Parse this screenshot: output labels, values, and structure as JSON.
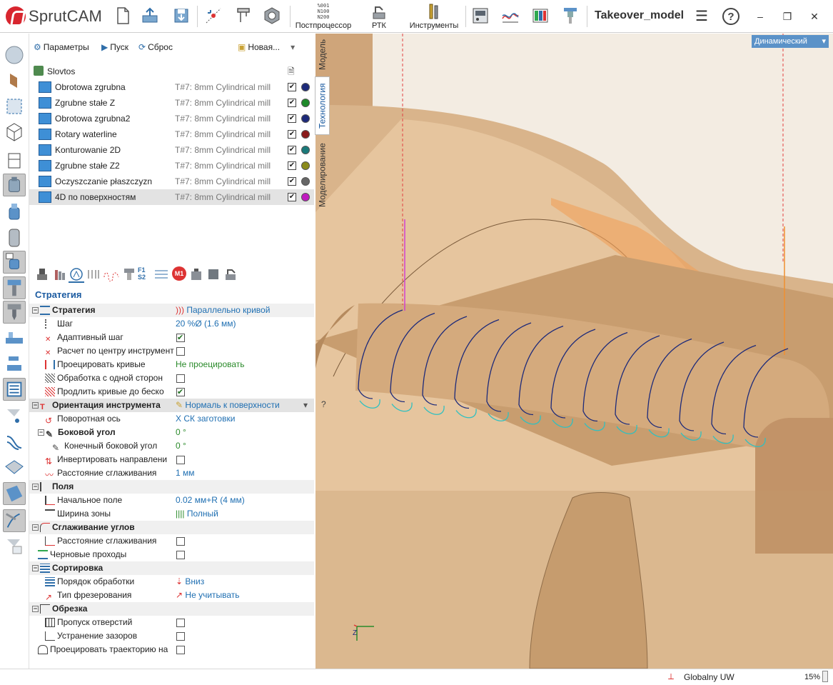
{
  "app": {
    "logo_text": "SprutCAM",
    "title": "Takeover_model"
  },
  "toolbar": {
    "postprocessor_label": "Постпроцессор",
    "postprocessor_icon_text": "%001\nN100\nN200",
    "rtk_label": "РТК",
    "tools_label": "Инструменты"
  },
  "panel_toolbar": {
    "params_label": "Параметры",
    "run_label": "Пуск",
    "reset_label": "Сброс",
    "new_label": "Новая..."
  },
  "vertical_tabs": {
    "model": "Модель",
    "technology": "Технология",
    "modeling": "Моделирование"
  },
  "tree": {
    "root": "Slovtos",
    "operations": [
      {
        "name": "Obrotowa zgrubna",
        "tool": "T#7: 8mm Cylindrical mill",
        "color": "#1d2a7a"
      },
      {
        "name": "Zgrubne stałe Z",
        "tool": "T#7: 8mm Cylindrical mill",
        "color": "#1e8a2a"
      },
      {
        "name": "Obrotowa zgrubna2",
        "tool": "T#7: 8mm Cylindrical mill",
        "color": "#1d2a7a"
      },
      {
        "name": "Rotary waterline",
        "tool": "T#7: 8mm Cylindrical mill",
        "color": "#8a1a1a"
      },
      {
        "name": "Konturowanie 2D",
        "tool": "T#7: 8mm Cylindrical mill",
        "color": "#1a7a7a"
      },
      {
        "name": "Zgrubne stałe Z2",
        "tool": "T#7: 8mm Cylindrical mill",
        "color": "#8a8a1a"
      },
      {
        "name": "Oczyszczanie płaszczyzn",
        "tool": "T#7: 8mm Cylindrical mill",
        "color": "#666666"
      },
      {
        "name": "4D по поверхностям",
        "tool": "T#7: 8mm Cylindrical mill",
        "color": "#c01ac0"
      }
    ]
  },
  "props_toolbar": {
    "f1": "F1",
    "s2": "S2",
    "m1": "M1"
  },
  "section_title": "Стратегия",
  "props": {
    "strategy_hdr": "Стратегия",
    "strategy_val": "Параллельно кривой",
    "step": "Шаг",
    "step_val": "20 %Ø (1.6 мм)",
    "adaptive": "Адаптивный шаг",
    "center_calc": "Расчет по центру инструмент",
    "project_curves": "Проецировать кривые",
    "project_curves_val": "Не проецировать",
    "one_side": "Обработка с одной сторон",
    "extend_curves": "Продлить кривые до беско",
    "orient_hdr": "Ориентация инструмента",
    "orient_val": "Нормаль к поверхности",
    "rot_axis": "Поворотная ось",
    "rot_axis_val": "X СК заготовки",
    "side_angle": "Боковой угол",
    "side_angle_val": "0 °",
    "end_side_angle": "Конечный боковой угол",
    "end_side_angle_val": "0 °",
    "invert_dir": "Инвертировать направлени",
    "smooth_dist": "Расстояние сглаживания",
    "smooth_dist_val": "1 мм",
    "fields_hdr": "Поля",
    "start_field": "Начальное поле",
    "start_field_val": "0.02 мм+R (4 мм)",
    "zone_width": "Ширина зоны",
    "zone_width_val": "Полный",
    "corner_smooth_hdr": "Сглаживание углов",
    "corner_smooth_dist": "Расстояние сглаживания",
    "rough_passes": "Черновые проходы",
    "sort_hdr": "Сортировка",
    "order": "Порядок обработки",
    "order_val": "Вниз",
    "mill_type": "Тип фрезерования",
    "mill_type_val": "Не учитывать",
    "trim_hdr": "Обрезка",
    "skip_holes": "Пропуск отверстий",
    "gap_fix": "Устранение зазоров",
    "project_path": "Проецировать траекторию на"
  },
  "viewport": {
    "mode": "Динамический",
    "axis_z": "Z"
  },
  "status": {
    "cs": "Globalny UW",
    "zoom": "15%"
  }
}
